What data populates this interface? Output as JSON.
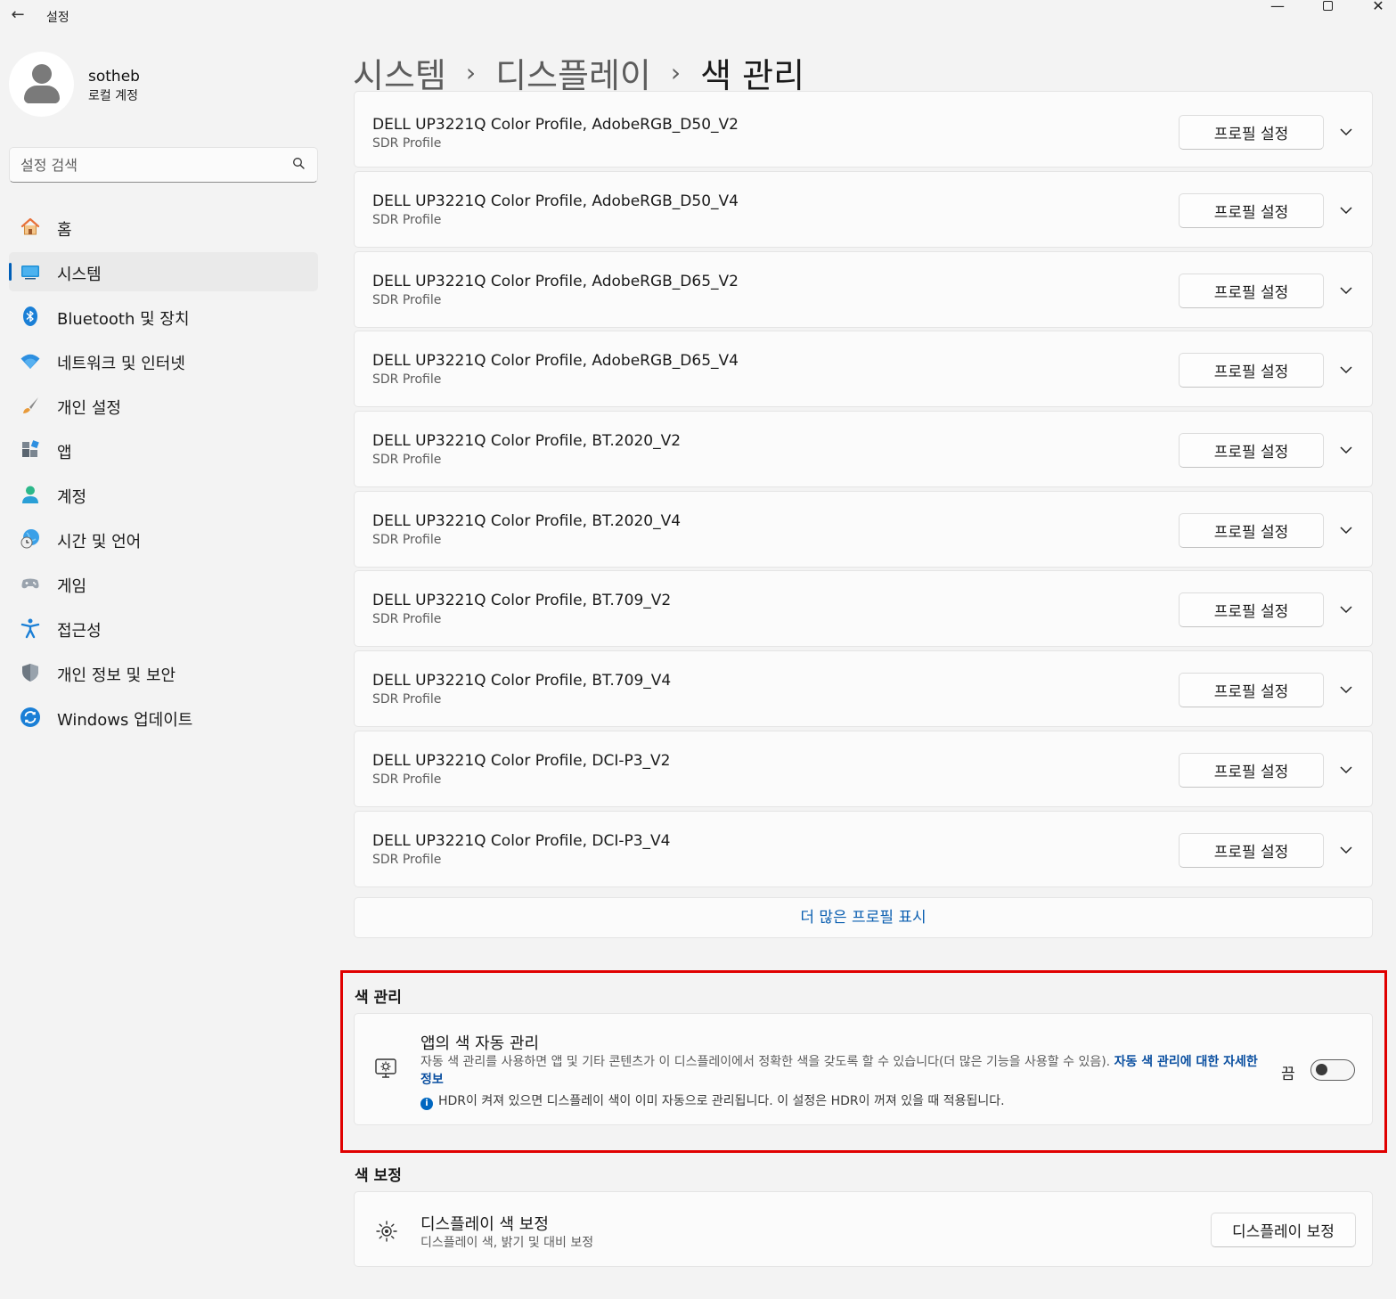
{
  "window": {
    "title": "설정",
    "back_icon": "←",
    "minimize_icon": "—",
    "close_icon": "✕"
  },
  "user": {
    "name": "sotheb",
    "account_type": "로컬 계정"
  },
  "search": {
    "placeholder": "설정 검색"
  },
  "nav": {
    "items": [
      {
        "label": "홈",
        "icon": "home-icon"
      },
      {
        "label": "시스템",
        "icon": "system-icon",
        "active": true
      },
      {
        "label": "Bluetooth 및 장치",
        "icon": "bluetooth-icon"
      },
      {
        "label": "네트워크 및 인터넷",
        "icon": "wifi-icon"
      },
      {
        "label": "개인 설정",
        "icon": "brush-icon"
      },
      {
        "label": "앱",
        "icon": "apps-icon"
      },
      {
        "label": "계정",
        "icon": "account-icon"
      },
      {
        "label": "시간 및 언어",
        "icon": "globe-clock-icon"
      },
      {
        "label": "게임",
        "icon": "gamepad-icon"
      },
      {
        "label": "접근성",
        "icon": "accessibility-icon"
      },
      {
        "label": "개인 정보 및 보안",
        "icon": "shield-icon"
      },
      {
        "label": "Windows 업데이트",
        "icon": "update-icon"
      }
    ]
  },
  "breadcrumb": {
    "items": [
      "시스템",
      "디스플레이",
      "색 관리"
    ],
    "separator": "›"
  },
  "profiles": {
    "button_label": "프로필 설정",
    "items": [
      {
        "name": "DELL UP3221Q Color Profile, AdobeRGB_D50_V2",
        "type": "SDR Profile"
      },
      {
        "name": "DELL UP3221Q Color Profile, AdobeRGB_D50_V4",
        "type": "SDR Profile"
      },
      {
        "name": "DELL UP3221Q Color Profile, AdobeRGB_D65_V2",
        "type": "SDR Profile"
      },
      {
        "name": "DELL UP3221Q Color Profile, AdobeRGB_D65_V4",
        "type": "SDR Profile"
      },
      {
        "name": "DELL UP3221Q Color Profile, BT.2020_V2",
        "type": "SDR Profile"
      },
      {
        "name": "DELL UP3221Q Color Profile, BT.2020_V4",
        "type": "SDR Profile"
      },
      {
        "name": "DELL UP3221Q Color Profile, BT.709_V2",
        "type": "SDR Profile"
      },
      {
        "name": "DELL UP3221Q Color Profile, BT.709_V4",
        "type": "SDR Profile"
      },
      {
        "name": "DELL UP3221Q Color Profile, DCI-P3_V2",
        "type": "SDR Profile"
      },
      {
        "name": "DELL UP3221Q Color Profile, DCI-P3_V4",
        "type": "SDR Profile"
      }
    ],
    "show_more_label": "더 많은 프로필 표시"
  },
  "color_management": {
    "section_title": "색 관리",
    "title": "앱의 색 자동 관리",
    "description": "자동 색 관리를 사용하면 앱 및 기타 콘텐츠가 이 디스플레이에서 정확한 색을 갖도록 할 수 있습니다(더 많은 기능을 사용할 수 있음). ",
    "link": "자동 색 관리에 대한 자세한 정보",
    "info": "HDR이 켜져 있으면 디스플레이 색이 이미 자동으로 관리됩니다. 이 설정은 HDR이 꺼져 있을 때 적용됩니다.",
    "info_icon": "i",
    "toggle_label": "끔",
    "toggle_on": false
  },
  "color_calibration": {
    "section_title": "색 보정",
    "title": "디스플레이 색 보정",
    "subtitle": "디스플레이 색, 밝기 및 대비 보정",
    "button_label": "디스플레이 보정"
  },
  "colors": {
    "accent": "#005fb8",
    "link": "#0a5eb0",
    "highlight_border": "#e00000"
  }
}
